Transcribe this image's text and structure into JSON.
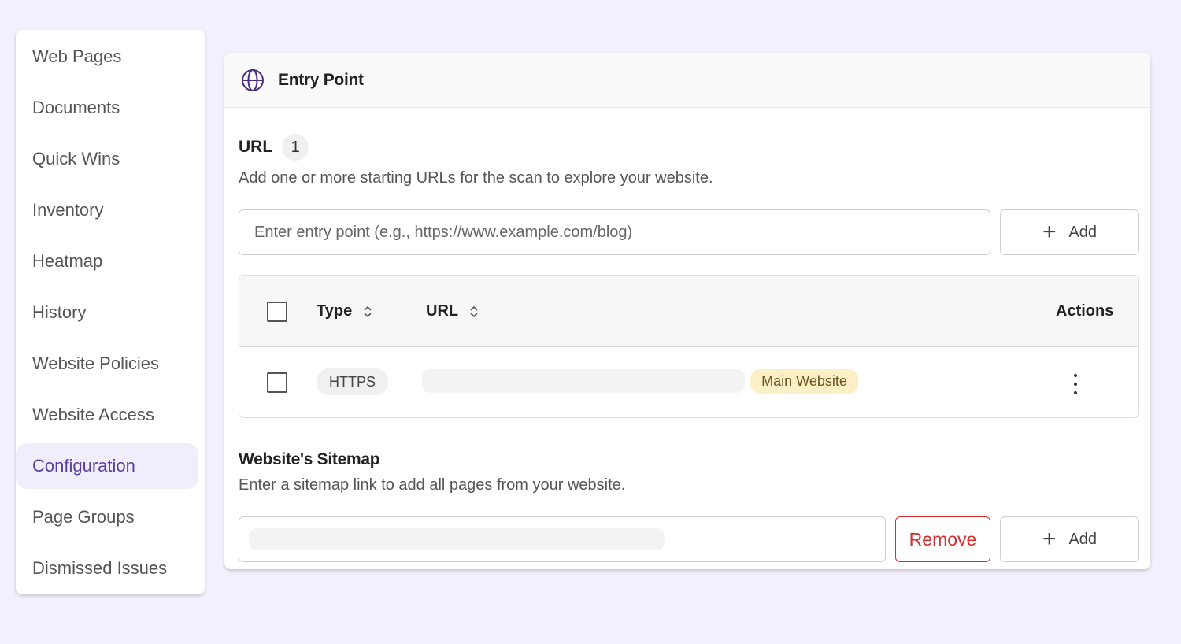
{
  "sidebar": {
    "items": [
      {
        "label": "Web Pages"
      },
      {
        "label": "Documents"
      },
      {
        "label": "Quick Wins"
      },
      {
        "label": "Inventory"
      },
      {
        "label": "Heatmap"
      },
      {
        "label": "History"
      },
      {
        "label": "Website Policies"
      },
      {
        "label": "Website Access"
      },
      {
        "label": "Configuration",
        "active": true
      },
      {
        "label": "Page Groups"
      },
      {
        "label": "Dismissed Issues"
      }
    ]
  },
  "card": {
    "title": "Entry Point",
    "icon": "globe-icon",
    "accent_color": "#4a2f7a"
  },
  "entry": {
    "label": "URL",
    "count": "1",
    "helper": "Add one or more starting URLs for the scan to explore your website.",
    "placeholder": "Enter entry point (e.g., https://www.example.com/blog)",
    "add_label": "Add"
  },
  "table": {
    "headers": {
      "type": "Type",
      "url": "URL",
      "actions": "Actions"
    },
    "rows": [
      {
        "type": "HTTPS",
        "tag": "Main Website"
      }
    ]
  },
  "sitemap": {
    "title": "Website's Sitemap",
    "helper": "Enter a sitemap link to add all pages from your website.",
    "remove_label": "Remove",
    "add_label": "Add"
  }
}
